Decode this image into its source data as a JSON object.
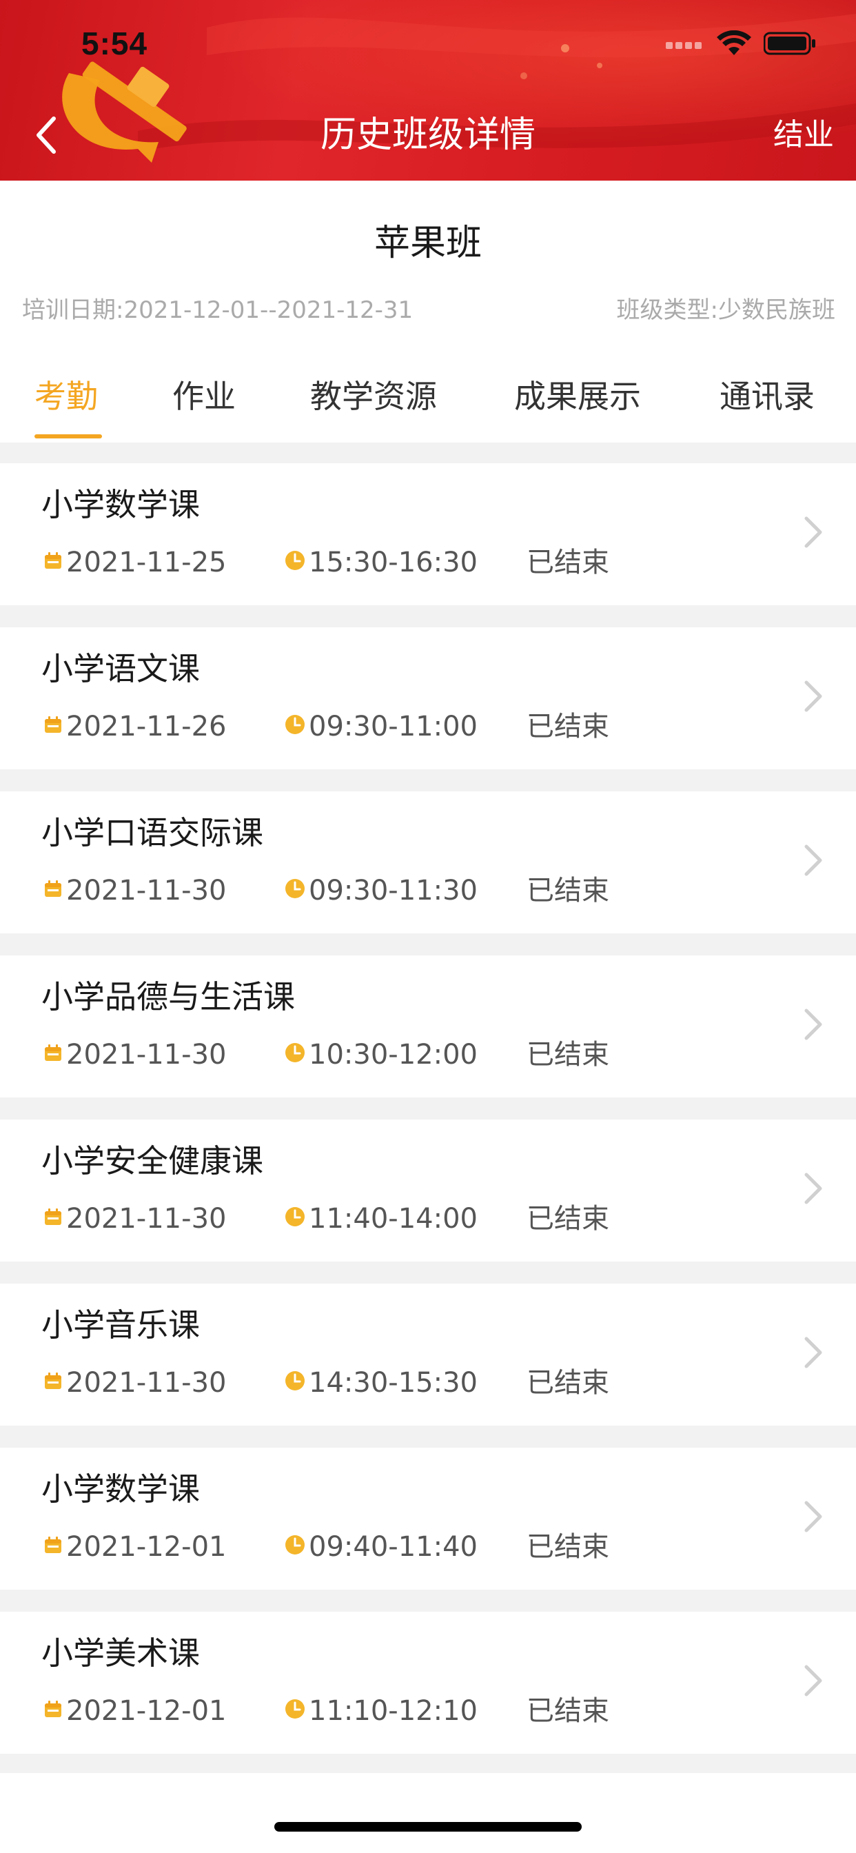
{
  "status_bar": {
    "time": "5:54"
  },
  "nav": {
    "title": "历史班级详情",
    "right_action": "结业"
  },
  "class_info": {
    "name": "苹果班",
    "training_date": "培训日期:2021-12-01--2021-12-31",
    "class_type": "班级类型:少数民族班"
  },
  "tabs": [
    {
      "label": "考勤"
    },
    {
      "label": "作业"
    },
    {
      "label": "教学资源"
    },
    {
      "label": "成果展示"
    },
    {
      "label": "通讯录"
    }
  ],
  "active_tab": "考勤",
  "colors": {
    "header_red": "#d81e22",
    "accent": "#f4a622",
    "list_bg": "#f2f2f2"
  },
  "courses": [
    {
      "title": "小学数学课",
      "date": "2021-11-25",
      "time": "15:30-16:30",
      "status": "已结束"
    },
    {
      "title": "小学语文课",
      "date": "2021-11-26",
      "time": "09:30-11:00",
      "status": "已结束"
    },
    {
      "title": "小学口语交际课",
      "date": "2021-11-30",
      "time": "09:30-11:30",
      "status": "已结束"
    },
    {
      "title": "小学品德与生活课",
      "date": "2021-11-30",
      "time": "10:30-12:00",
      "status": "已结束"
    },
    {
      "title": "小学安全健康课",
      "date": "2021-11-30",
      "time": "11:40-14:00",
      "status": "已结束"
    },
    {
      "title": "小学音乐课",
      "date": "2021-11-30",
      "time": "14:30-15:30",
      "status": "已结束"
    },
    {
      "title": "小学数学课",
      "date": "2021-12-01",
      "time": "09:40-11:40",
      "status": "已结束"
    },
    {
      "title": "小学美术课",
      "date": "2021-12-01",
      "time": "11:10-12:10",
      "status": "已结束"
    }
  ]
}
